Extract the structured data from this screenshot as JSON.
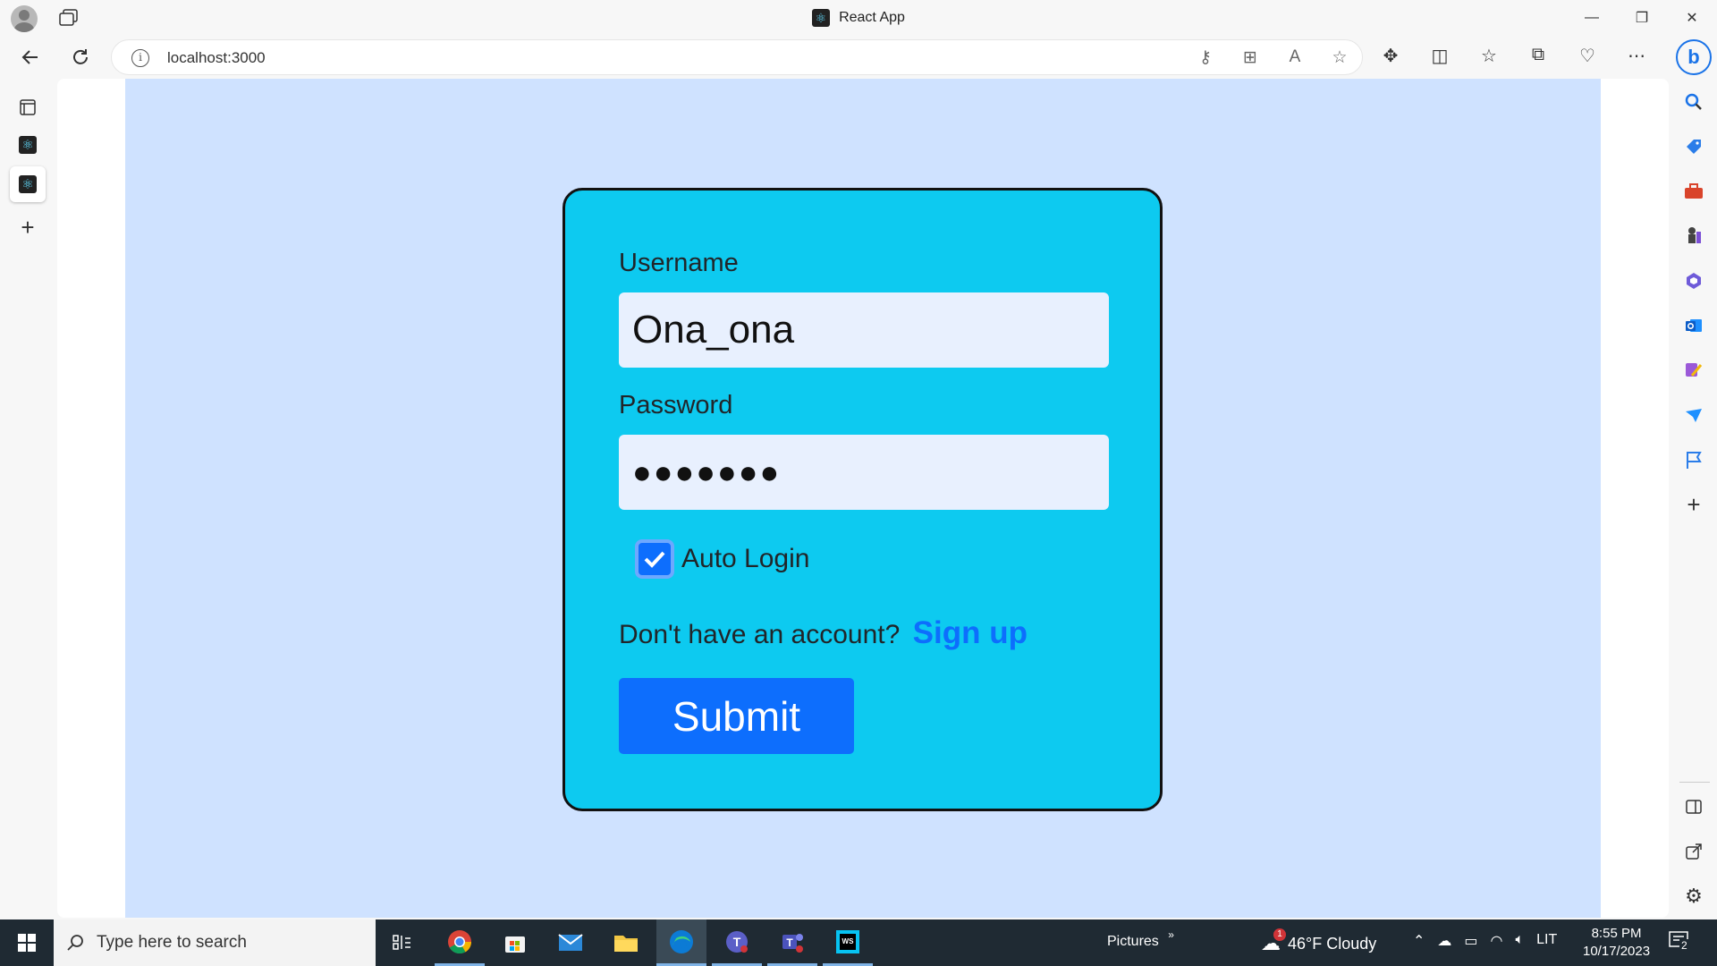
{
  "window": {
    "title": "React App",
    "favicon_icon": "react-icon",
    "controls": [
      "—",
      "❐",
      "✕"
    ]
  },
  "addressbar": {
    "url": "localhost:3000"
  },
  "sidebar_right": {
    "icons": [
      "search-icon",
      "tag-icon",
      "toolbox-icon",
      "chess-icon",
      "office-icon",
      "outlook-icon",
      "designer-icon",
      "send-icon",
      "flag-icon",
      "add-icon",
      "split-icon",
      "external-icon",
      "settings-icon"
    ]
  },
  "form": {
    "username_label": "Username",
    "username_value": "Ona_ona",
    "password_label": "Password",
    "password_value": "●●●●●●●",
    "auto_login_label": "Auto Login",
    "auto_login_checked": true,
    "account_prompt": "Don't have an account?",
    "signup_link": "Sign up",
    "submit_label": "Submit"
  },
  "taskbar": {
    "search_placeholder": "Type here to search",
    "pictures_label": "Pictures",
    "weather_text": "46°F  Cloudy",
    "weather_badge": "1",
    "language": "LIT",
    "time": "8:55 PM",
    "date": "10/17/2023",
    "notifications_count": "2"
  },
  "colors": {
    "page_bg": "#cfe2ff",
    "card_bg": "#0dcaf0",
    "primary": "#0d6efd",
    "input_bg": "#e8f0fe"
  }
}
